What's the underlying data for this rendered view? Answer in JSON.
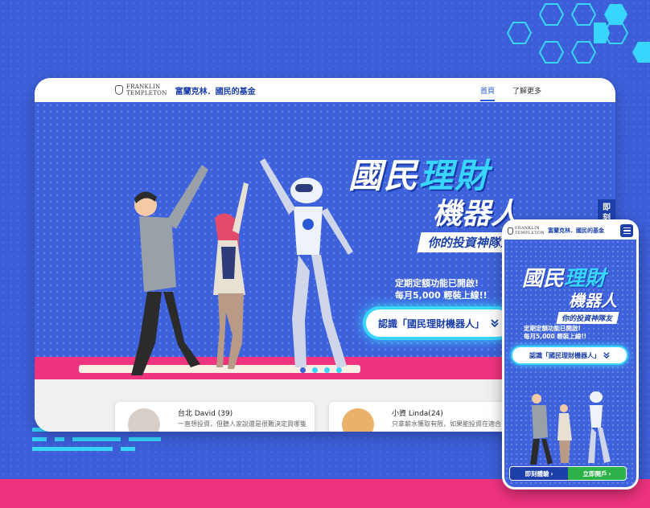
{
  "brand": {
    "logo_line1": "FRANKLIN",
    "logo_line2": "TEMPLETON",
    "name_cn": "富蘭克林．國民的基金"
  },
  "nav": {
    "home": "首頁",
    "more": "了解更多"
  },
  "hero": {
    "title_part1": "國民",
    "title_part2": "理財",
    "title_line2": "機器人",
    "subtitle": "你的投資神隊友",
    "promo_line1": "定期定額功能已開啟!",
    "promo_line2": "每月5,000 輕裝上線!!",
    "cta_label": "認識「國民理財機器人」",
    "cta_icon": "double-chevron-down-icon"
  },
  "side_tab": {
    "char1": "即",
    "char2": "刻"
  },
  "testimonials": [
    {
      "name": "台北 David (39)",
      "quote": "一直想投資，但聽人家說還是很難決定買哪隻"
    },
    {
      "name": "小資 Linda(24)",
      "quote": "只拿薪水獲取有限，如果能投資在適合自己的"
    }
  ],
  "carousel": {
    "count": 4,
    "active": 0
  },
  "mobile": {
    "cta_label": "認識「國民理財機器人」",
    "experience_label": "即刻體驗",
    "open_label": "立即開戶"
  },
  "colors": {
    "bg_blue": "#3c5ed9",
    "accent_cyan": "#38d6ff",
    "accent_pink": "#f0337f",
    "brand_navy": "#1c3faa",
    "open_green": "#2db24a"
  }
}
